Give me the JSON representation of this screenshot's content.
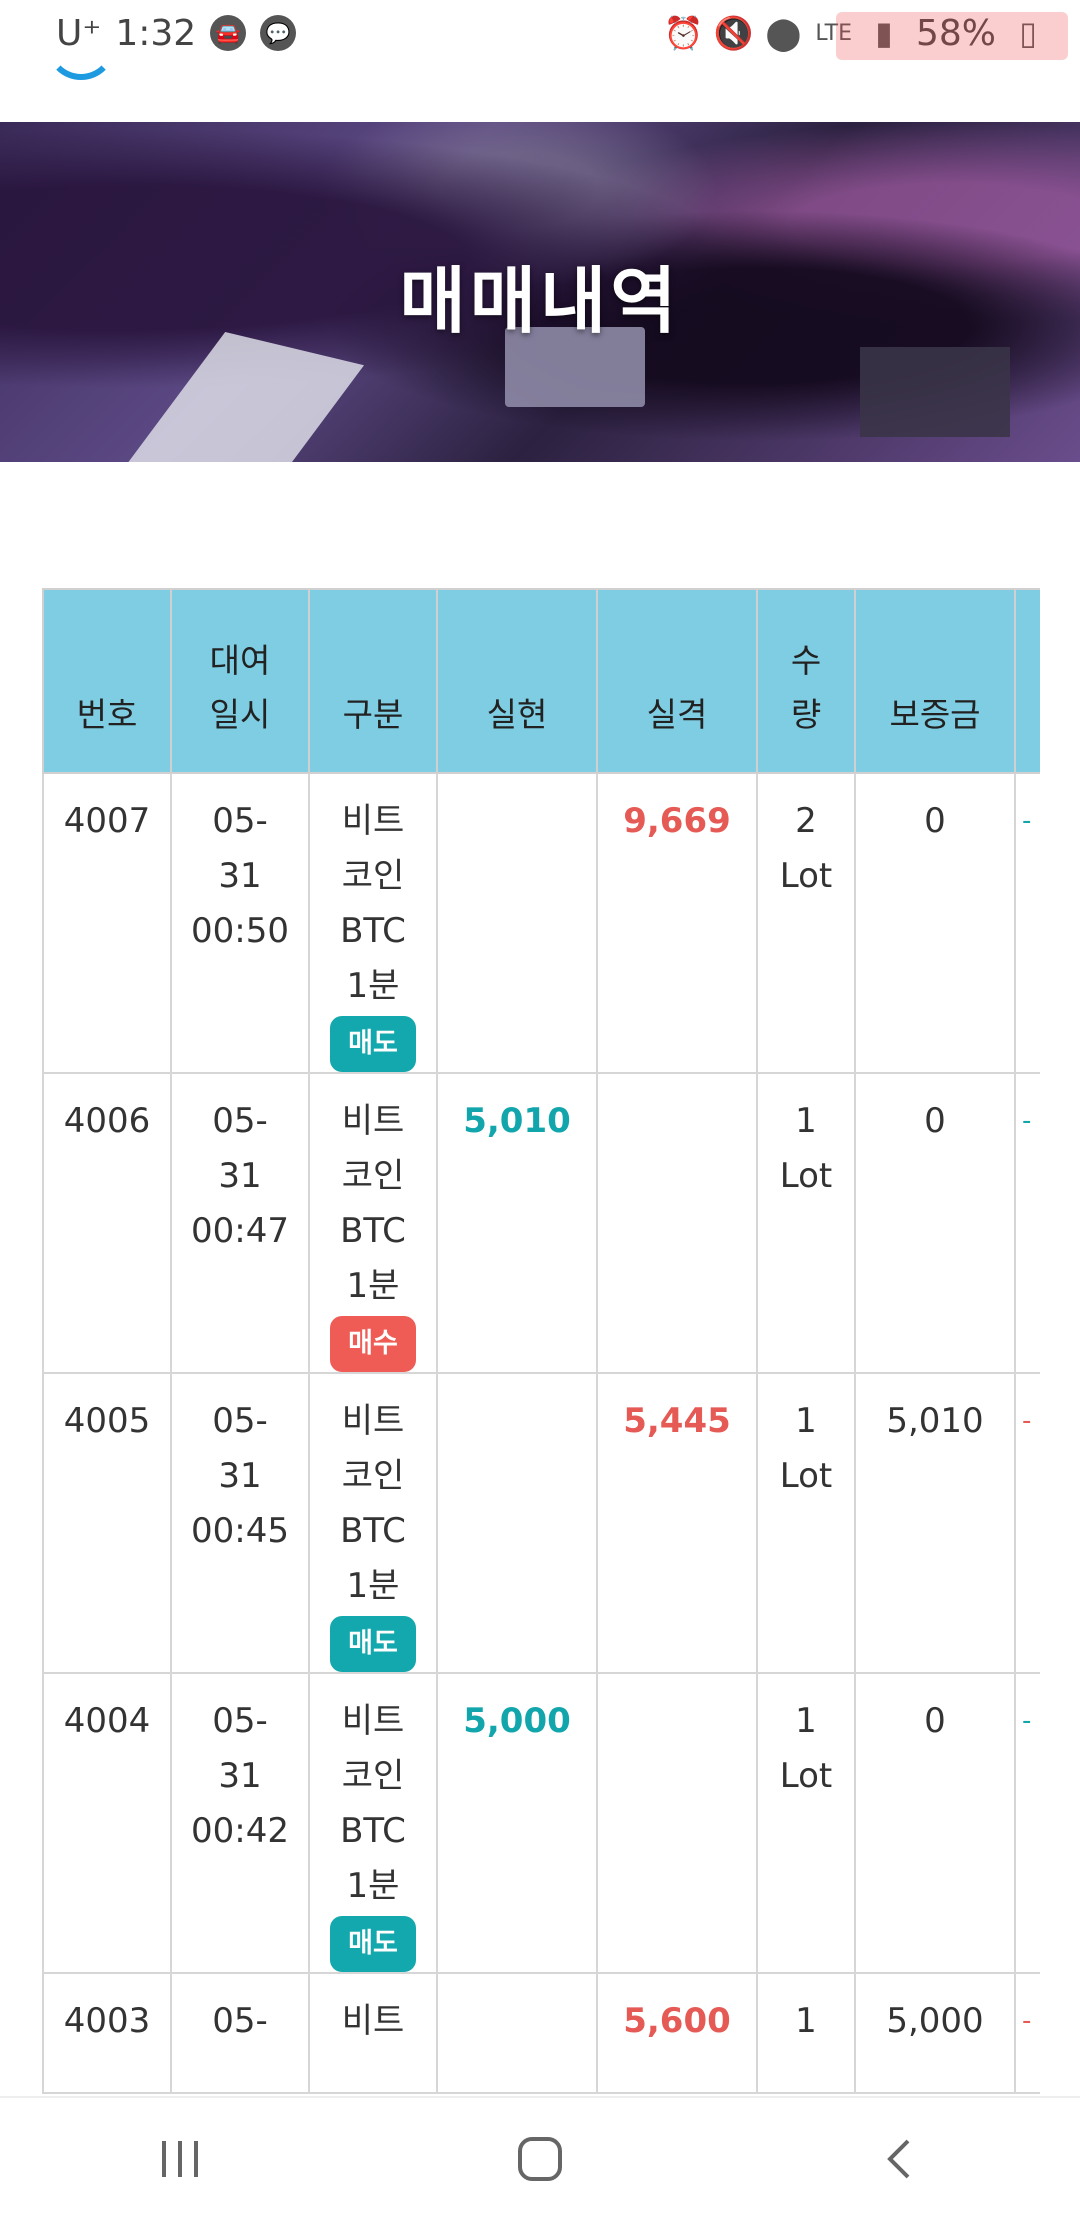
{
  "status": {
    "carrier": "U⁺",
    "time": "1:32",
    "battery": "58%",
    "network": "LTE"
  },
  "banner": {
    "title": "매매내역"
  },
  "table": {
    "headers": [
      "번호",
      "대여\n일시",
      "구분",
      "실현",
      "실격",
      "수\n량",
      "보증금",
      ""
    ],
    "rows": [
      {
        "num": "4007",
        "date": "05-\n31\n00:50",
        "type": "비트\n코인\nBTC\n1분",
        "badge": "매도",
        "badge_kind": "sell",
        "realized": "",
        "loss": "9,669",
        "qty": "2\nLot",
        "deposit": "0",
        "extra_color": "#12a6ac"
      },
      {
        "num": "4006",
        "date": "05-\n31\n00:47",
        "type": "비트\n코인\nBTC\n1분",
        "badge": "매수",
        "badge_kind": "buy",
        "realized": "5,010",
        "loss": "",
        "qty": "1\nLot",
        "deposit": "0",
        "extra_color": "#12a6ac"
      },
      {
        "num": "4005",
        "date": "05-\n31\n00:45",
        "type": "비트\n코인\nBTC\n1분",
        "badge": "매도",
        "badge_kind": "sell",
        "realized": "",
        "loss": "5,445",
        "qty": "1\nLot",
        "deposit": "5,010",
        "extra_color": "#e55a55"
      },
      {
        "num": "4004",
        "date": "05-\n31\n00:42",
        "type": "비트\n코인\nBTC\n1분",
        "badge": "매도",
        "badge_kind": "sell",
        "realized": "5,000",
        "loss": "",
        "qty": "1\nLot",
        "deposit": "0",
        "extra_color": "#12a6ac"
      },
      {
        "num": "4003",
        "date": "05-",
        "type": "비트",
        "badge": "",
        "badge_kind": "",
        "realized": "",
        "loss": "5,600",
        "qty": "1",
        "deposit": "5,000",
        "extra_color": "#e55a55"
      }
    ]
  },
  "nav": {
    "recent_icon": "recent-apps-icon",
    "home_icon": "home-icon",
    "back_icon": "back-icon"
  }
}
